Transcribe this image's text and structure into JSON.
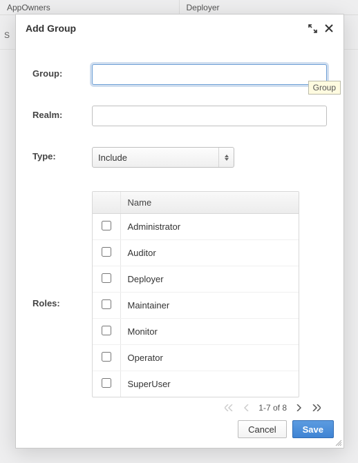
{
  "background": {
    "col1": "AppOwners",
    "col2": "Deployer",
    "row2_left": "S"
  },
  "dialog": {
    "title": "Add Group",
    "tooltip": "Group"
  },
  "form": {
    "group_label": "Group:",
    "group_value": "",
    "realm_label": "Realm:",
    "realm_value": "",
    "type_label": "Type:",
    "type_value": "Include",
    "roles_label": "Roles:"
  },
  "grid": {
    "header_chk": "",
    "header_name": "Name",
    "rows": [
      {
        "name": "Administrator"
      },
      {
        "name": "Auditor"
      },
      {
        "name": "Deployer"
      },
      {
        "name": "Maintainer"
      },
      {
        "name": "Monitor"
      },
      {
        "name": "Operator"
      },
      {
        "name": "SuperUser"
      }
    ],
    "pager_text": "1-7 of 8"
  },
  "buttons": {
    "cancel": "Cancel",
    "save": "Save"
  }
}
